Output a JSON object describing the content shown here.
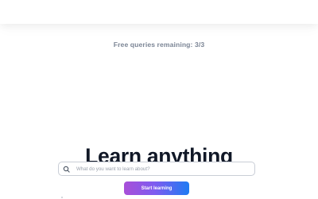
{
  "header": {
    "quota_text": "Free queries remaining: 3/3"
  },
  "hero": {
    "title": "Learn anything"
  },
  "search": {
    "placeholder": "What do you want to learn about?",
    "value": "",
    "icon": "search-icon"
  },
  "actions": {
    "start_label": "Start learning"
  },
  "colors": {
    "title": "#111827",
    "quota": "#7b8595",
    "button_gradient_start": "#a94fd8",
    "button_gradient_end": "#1e7bf2"
  }
}
